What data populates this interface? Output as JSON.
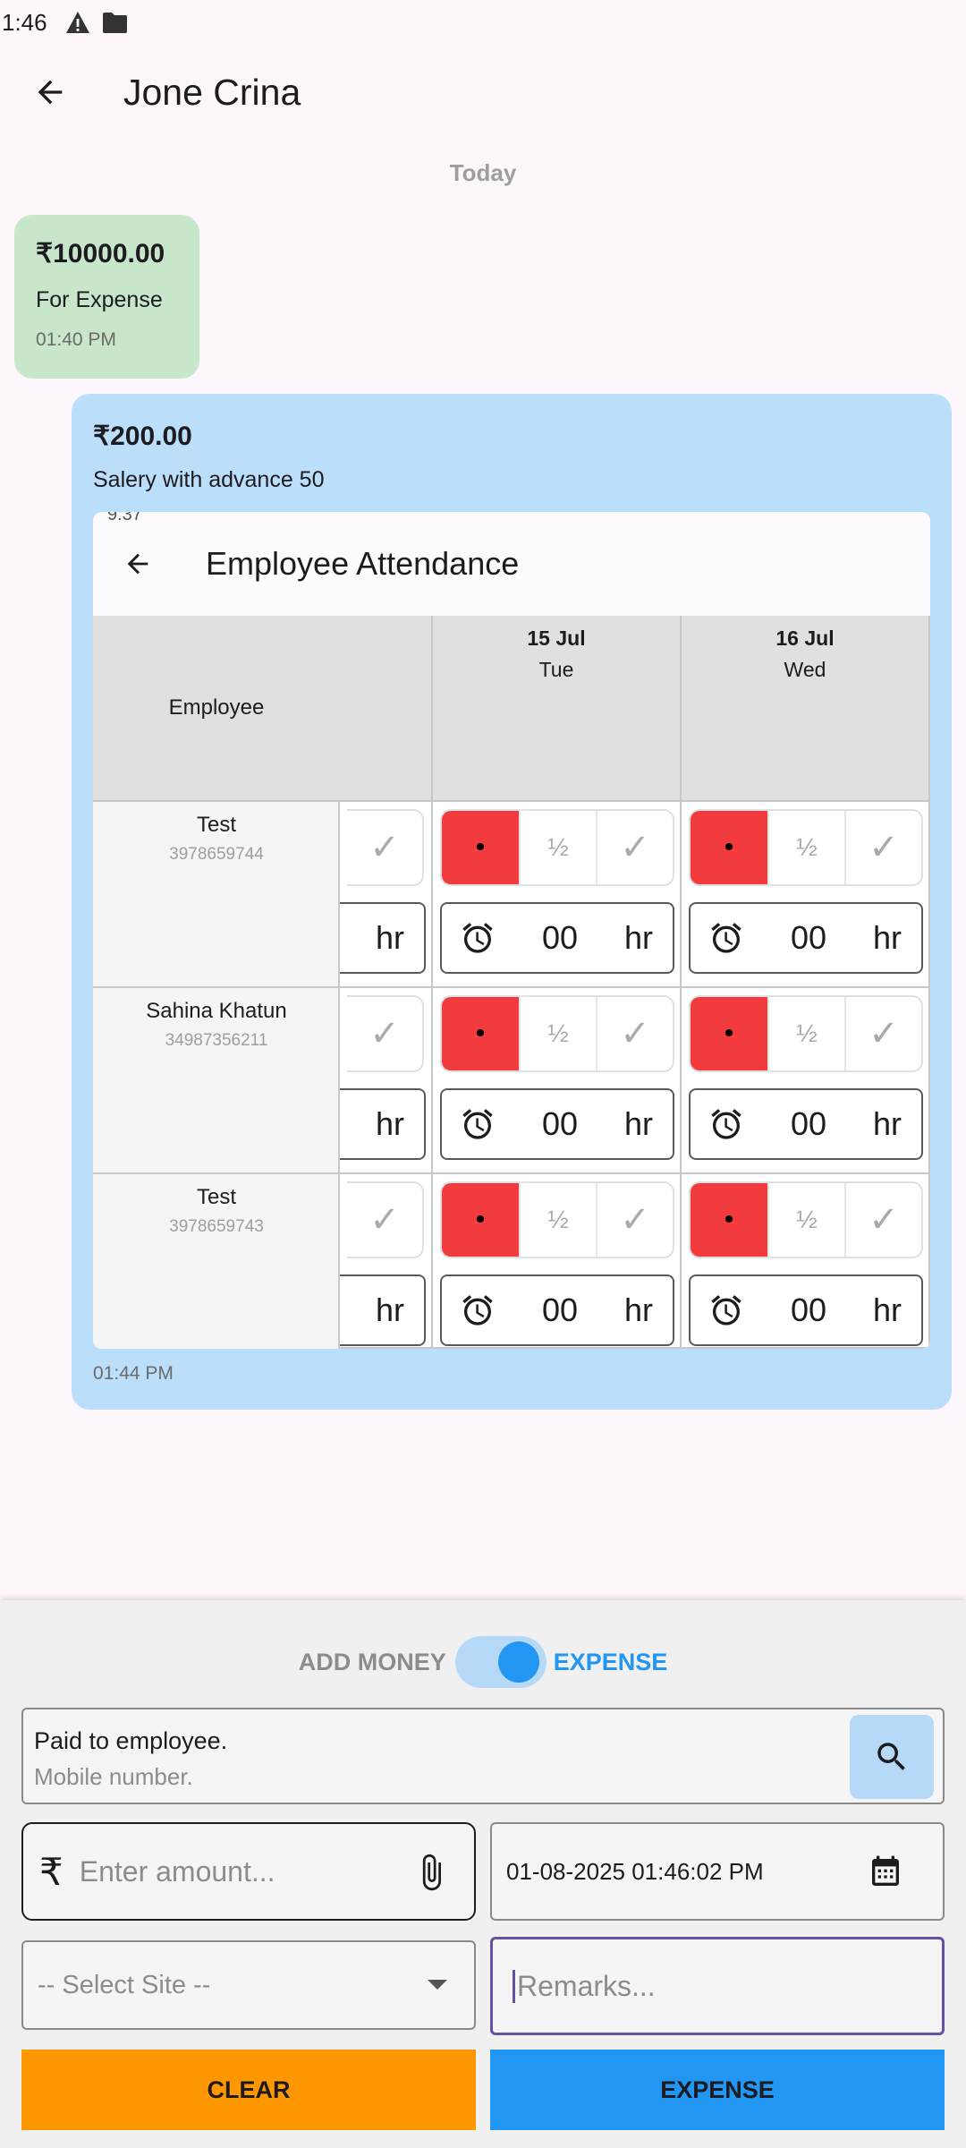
{
  "status_bar": {
    "time": "1:46",
    "icons": [
      "warning-icon",
      "sd-card-icon"
    ]
  },
  "app_bar": {
    "title": "Jone Crina",
    "back_icon": "arrow-back-icon"
  },
  "chat": {
    "date_separator": "Today",
    "incoming": {
      "amount": "₹10000.00",
      "note": "For Expense",
      "time": "01:40 PM",
      "color": "#c8e6c9"
    },
    "outgoing": {
      "amount": "₹200.00",
      "note": "Salery with advance 50",
      "time": "01:44 PM",
      "color": "#bbdefb",
      "attachment": {
        "clipped_status_time": "9:37",
        "title": "Employee Attendance",
        "employee_header": "Employee",
        "dates": [
          {
            "date": "15 Jul",
            "day": "Tue"
          },
          {
            "date": "16 Jul",
            "day": "Wed"
          }
        ],
        "employees": [
          {
            "name": "Test",
            "phone": "3978659744"
          },
          {
            "name": "Sahina Khatun",
            "phone": "34987356211"
          },
          {
            "name": "Test",
            "phone": "3978659743"
          }
        ],
        "cell": {
          "absent_mark": "•",
          "half_mark": "½",
          "present_mark": "✓",
          "hours_value": "00",
          "hours_unit": "hr"
        },
        "absent_color": "#f23b3d"
      }
    }
  },
  "form": {
    "toggle": {
      "left_label": "ADD MONEY",
      "right_label": "EXPENSE",
      "state": "expense",
      "accent": "#2196f3"
    },
    "employee_search": {
      "text": "Paid to employee.",
      "placeholder": "Mobile number.",
      "button_icon": "search-icon"
    },
    "amount": {
      "currency_symbol": "₹",
      "placeholder": "Enter amount...",
      "attach_icon": "paperclip-icon"
    },
    "datetime": {
      "value": "01-08-2025 01:46:02 PM",
      "icon": "calendar-icon"
    },
    "site": {
      "value": "-- Select Site --"
    },
    "remarks": {
      "placeholder": "Remarks..."
    },
    "buttons": {
      "clear": "CLEAR",
      "expense": "EXPENSE",
      "clear_color": "#ff9800",
      "expense_color": "#2196f3"
    }
  }
}
